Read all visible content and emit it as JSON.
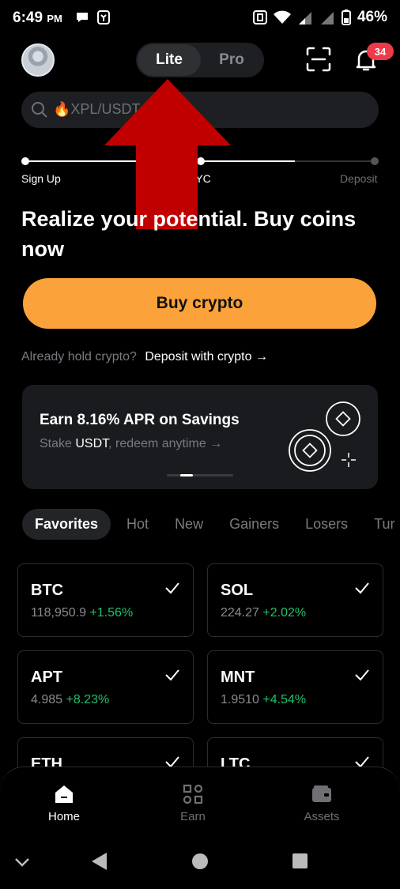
{
  "status": {
    "time": "6:49",
    "ampm": "PM",
    "battery": "46%"
  },
  "header": {
    "mode_lite": "Lite",
    "mode_pro": "Pro",
    "notification_count": "34"
  },
  "search": {
    "placeholder": "XPL/USDT"
  },
  "onboarding": {
    "steps": [
      "Sign Up",
      "KYC",
      "Deposit"
    ],
    "headline": "Realize your potential. Buy coins now",
    "buy_label": "Buy crypto",
    "hold_text": "Already hold crypto?",
    "deposit_link": "Deposit with crypto"
  },
  "savings_card": {
    "title": "Earn 8.16% APR on Savings",
    "sub_prefix": "Stake",
    "sub_token": "USDT",
    "sub_suffix": ", redeem anytime"
  },
  "tabs": [
    "Favorites",
    "Hot",
    "New",
    "Gainers",
    "Losers",
    "Tur"
  ],
  "coins": [
    {
      "symbol": "BTC",
      "price": "118,950.9",
      "change": "+1.56%"
    },
    {
      "symbol": "SOL",
      "price": "224.27",
      "change": "+2.02%"
    },
    {
      "symbol": "APT",
      "price": "4.985",
      "change": "+8.23%"
    },
    {
      "symbol": "MNT",
      "price": "1.9510",
      "change": "+4.54%"
    },
    {
      "symbol": "ETH",
      "price": "",
      "change": ""
    },
    {
      "symbol": "LTC",
      "price": "",
      "change": ""
    }
  ],
  "nav": {
    "home": "Home",
    "earn": "Earn",
    "assets": "Assets"
  },
  "colors": {
    "accent": "#fca23a",
    "positive": "#1fc16b",
    "badge": "#ef3a4a",
    "overlay_arrow": "#c00000"
  }
}
